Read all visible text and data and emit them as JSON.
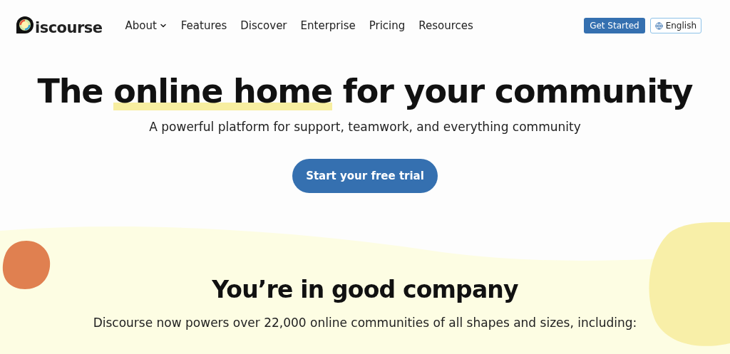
{
  "header": {
    "logo_text": "iscourse",
    "nav": [
      {
        "label": "About",
        "dropdown": true
      },
      {
        "label": "Features",
        "dropdown": false
      },
      {
        "label": "Discover",
        "dropdown": false
      },
      {
        "label": "Enterprise",
        "dropdown": false
      },
      {
        "label": "Pricing",
        "dropdown": false
      },
      {
        "label": "Resources",
        "dropdown": false
      }
    ],
    "cta": "Get Started",
    "language": "English"
  },
  "hero": {
    "title_before": "The ",
    "title_highlight": "online home",
    "title_after": " for your community",
    "subtitle": "A powerful platform for support, teamwork, and everything community",
    "button": "Start your free trial"
  },
  "section": {
    "title": "You’re in good company",
    "text": "Discourse now powers over 22,000 online communities of all shapes and sizes, including:"
  }
}
